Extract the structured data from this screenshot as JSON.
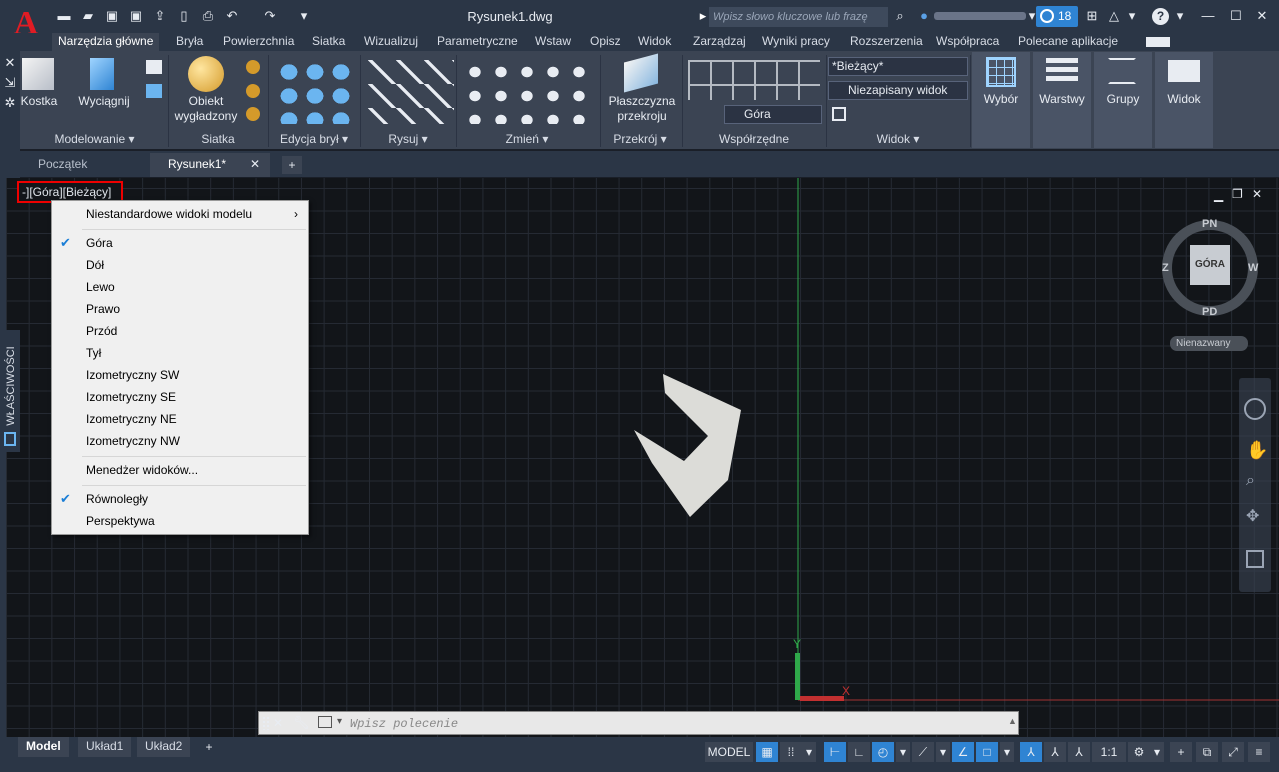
{
  "app": {
    "title": "Rysunek1.dwg",
    "search_placeholder": "Wpisz słowo kluczowe lub frazę",
    "notif_count": "18"
  },
  "ribbon_tabs": [
    "Narzędzia główne",
    "Bryła",
    "Powierzchnia",
    "Siatka",
    "Wizualizuj",
    "Parametryczne",
    "Wstaw",
    "Opisz",
    "Widok",
    "Zarządzaj",
    "Wyniki pracy",
    "Rozszerzenia",
    "Współpraca",
    "Polecane aplikacje"
  ],
  "panels": {
    "modelowanie": "Modelowanie ▾",
    "siatka": "Siatka",
    "edycja": "Edycja brył ▾",
    "rysuj": "Rysuj ▾",
    "zmien": "Zmień ▾",
    "przekroj": "Przekrój ▾",
    "wspolrzedne": "Współrzędne",
    "widok": "Widok ▾"
  },
  "buttons": {
    "kostka": "Kostka",
    "wyciagnij": "Wyciągnij",
    "obiekt1": "Obiekt",
    "obiekt2": "wygładzony",
    "plaszczyzna1": "Płaszczyzna",
    "plaszczyzna2": "przekroju",
    "wybor": "Wybór",
    "warstwy": "Warstwy",
    "grupy": "Grupy",
    "widok": "Widok"
  },
  "dropdowns": {
    "visual_style": "*Bieżący*",
    "named_view": "Niezapisany widok",
    "ucs_view": "Góra"
  },
  "doc_tabs": {
    "start": "Początek",
    "current": "Rysunek1*"
  },
  "viewport_label": "-][Góra][Bieżący]",
  "menu": {
    "custom": "Niestandardowe widoki modelu",
    "views": [
      "Góra",
      "Dół",
      "Lewo",
      "Prawo",
      "Przód",
      "Tył",
      "Izometryczny SW",
      "Izometryczny SE",
      "Izometryczny NE",
      "Izometryczny NW"
    ],
    "manager": "Menedżer widoków...",
    "parallel": "Równoległy",
    "perspective": "Perspektywa"
  },
  "viewcube": {
    "n": "PN",
    "s": "PD",
    "w": "Z",
    "e": "W",
    "face": "GÓRA",
    "ucs": "Nienazwany"
  },
  "side_palette": "WŁAŚCIWOŚCI",
  "command_placeholder": "Wpisz polecenie",
  "layout_tabs": [
    "Model",
    "Układ1",
    "Układ2"
  ],
  "status": {
    "model": "MODEL",
    "scale": "1:1"
  },
  "colors": {
    "accent": "#2f84d3",
    "logo": "#e01c24",
    "highlight": "#ff0000"
  }
}
